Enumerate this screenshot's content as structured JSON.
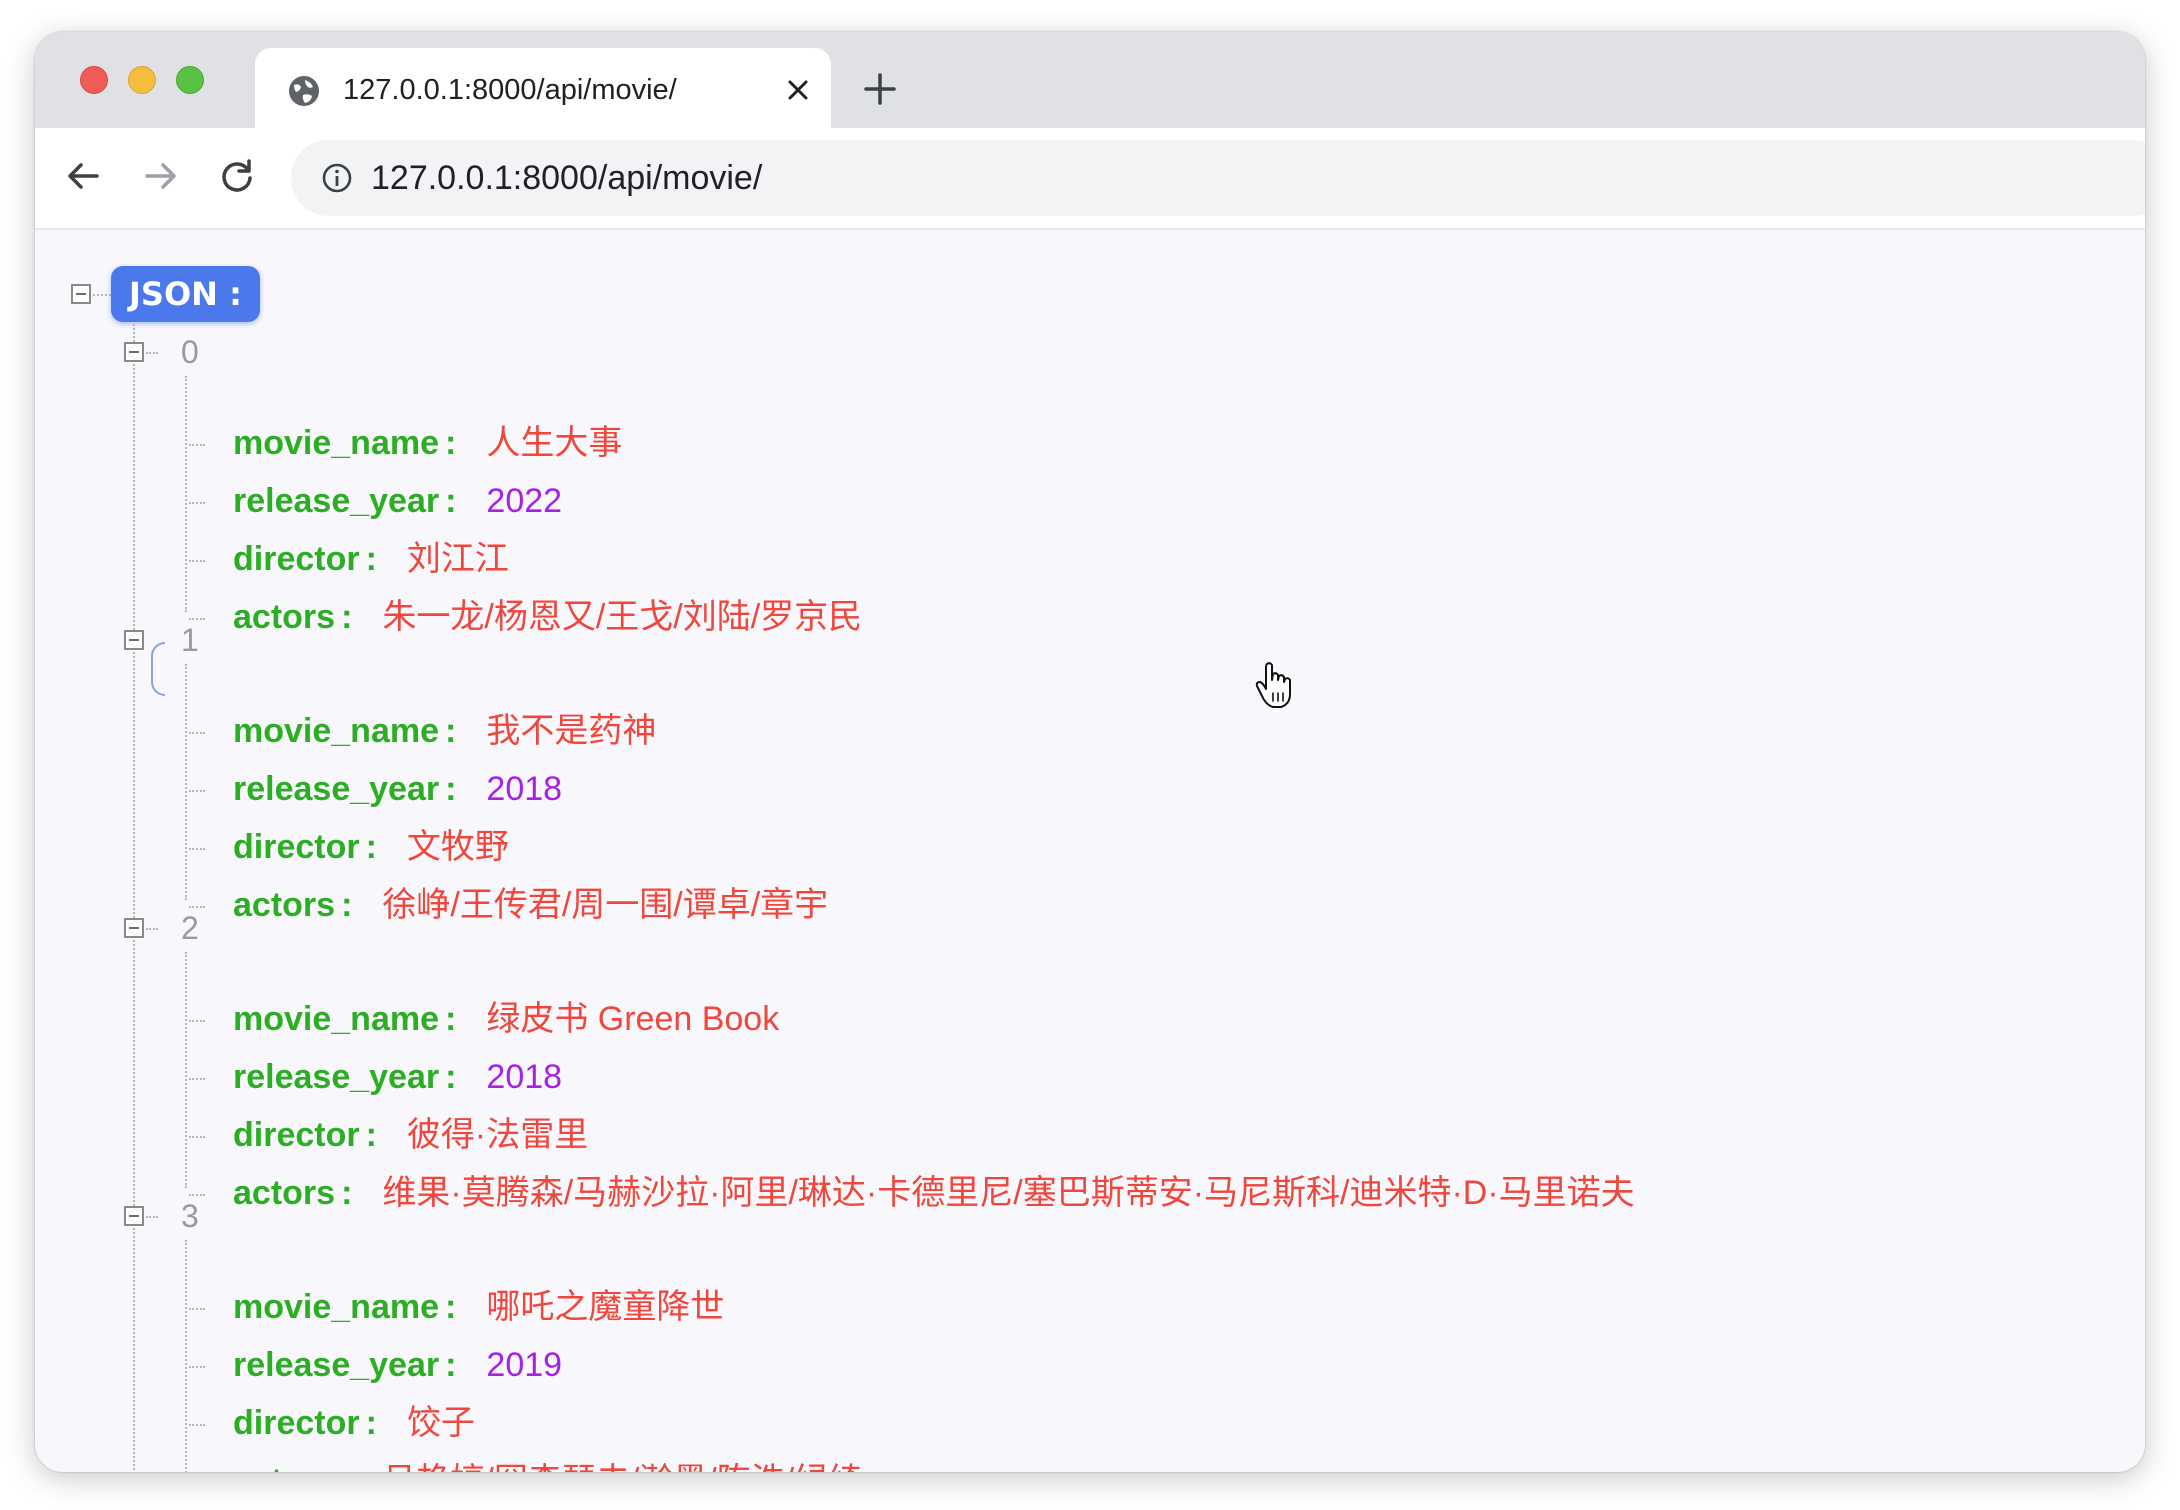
{
  "browser": {
    "tab_title": "127.0.0.1:8000/api/movie/",
    "url": "127.0.0.1:8000/api/movie/"
  },
  "json_viewer": {
    "root_label": "JSON :",
    "items": [
      {
        "index": "0",
        "fields": [
          {
            "key": "movie_name",
            "value": "人生大事",
            "type": "string"
          },
          {
            "key": "release_year",
            "value": "2022",
            "type": "number"
          },
          {
            "key": "director",
            "value": "刘江江",
            "type": "string"
          },
          {
            "key": "actors",
            "value": "朱一龙/杨恩又/王戈/刘陆/罗京民",
            "type": "string"
          }
        ]
      },
      {
        "index": "1",
        "fields": [
          {
            "key": "movie_name",
            "value": "我不是药神",
            "type": "string"
          },
          {
            "key": "release_year",
            "value": "2018",
            "type": "number"
          },
          {
            "key": "director",
            "value": "文牧野",
            "type": "string"
          },
          {
            "key": "actors",
            "value": "徐峥/王传君/周一围/谭卓/章宇",
            "type": "string"
          }
        ]
      },
      {
        "index": "2",
        "fields": [
          {
            "key": "movie_name",
            "value": "绿皮书 Green Book",
            "type": "string"
          },
          {
            "key": "release_year",
            "value": "2018",
            "type": "number"
          },
          {
            "key": "director",
            "value": "彼得·法雷里",
            "type": "string"
          },
          {
            "key": "actors",
            "value": "维果·莫腾森/马赫沙拉·阿里/琳达·卡德里尼/塞巴斯蒂安·马尼斯科/迪米特·D·马里诺夫",
            "type": "string"
          }
        ]
      },
      {
        "index": "3",
        "fields": [
          {
            "key": "movie_name",
            "value": "哪吒之魔童降世",
            "type": "string"
          },
          {
            "key": "release_year",
            "value": "2019",
            "type": "number"
          },
          {
            "key": "director",
            "value": "饺子",
            "type": "string"
          },
          {
            "key": "actors",
            "value": "吕艳婷/囧森瑟夫/瀚墨/陈浩/绿绮",
            "type": "string"
          }
        ]
      }
    ]
  },
  "colors": {
    "key": "#2cae24",
    "string": "#f0463c",
    "number": "#a820e6",
    "badge": "#4b79ec"
  }
}
